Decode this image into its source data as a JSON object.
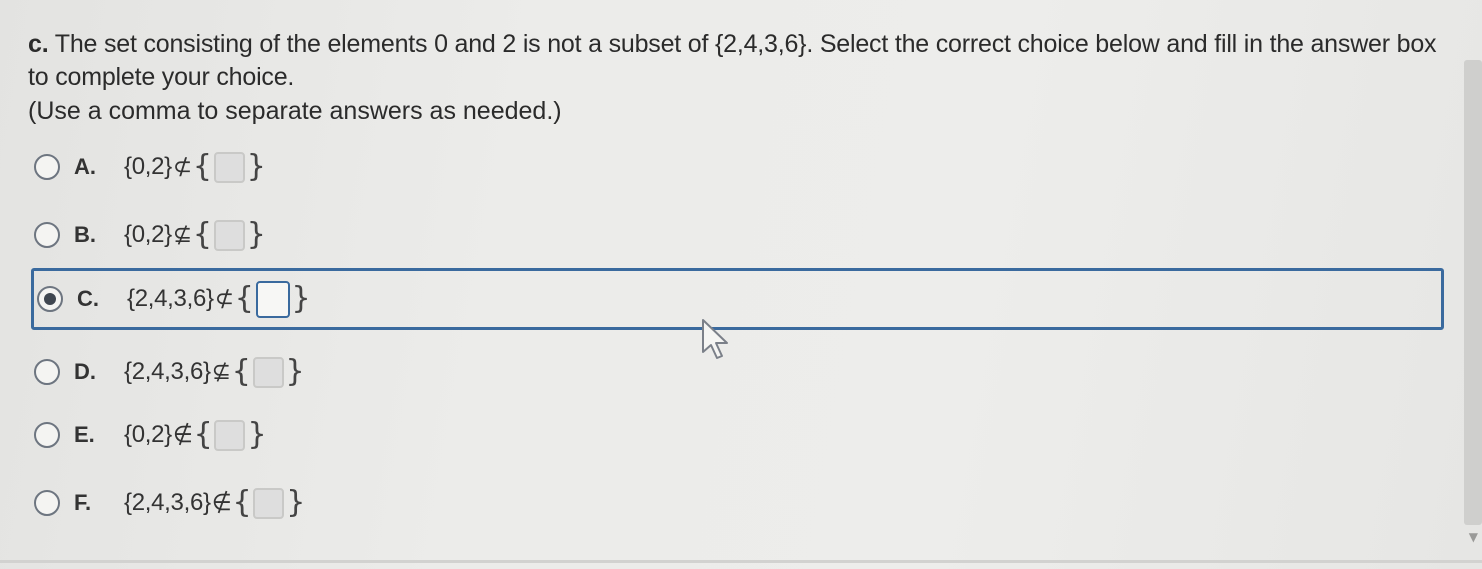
{
  "question": {
    "label": "c.",
    "text": "The set consisting of the elements 0 and 2 is not a subset of {2,4,3,6}. Select the correct choice below and fill in the answer box to complete your choice.",
    "hint": "(Use a comma to separate answers as needed.)"
  },
  "choices": [
    {
      "letter": "A.",
      "left": "{0,2}",
      "symbol": "⊄",
      "selected": false
    },
    {
      "letter": "B.",
      "left": "{0,2}",
      "symbol": "⊈",
      "selected": false
    },
    {
      "letter": "C.",
      "left": "{2,4,3,6}",
      "symbol": "⊄",
      "selected": true
    },
    {
      "letter": "D.",
      "left": "{2,4,3,6}",
      "symbol": "⊈",
      "selected": false
    },
    {
      "letter": "E.",
      "left": "{0,2}",
      "symbol": "∉",
      "selected": false
    },
    {
      "letter": "F.",
      "left": "{2,4,3,6}",
      "symbol": "∉",
      "selected": false
    }
  ],
  "answer_box_value": "",
  "brace_open": "{",
  "brace_close": "}",
  "colors": {
    "accent": "#3a6a9e",
    "text": "#2b2b2b",
    "background": "#ececea"
  },
  "icons": [
    "radio-button-icon",
    "mouse-pointer-icon"
  ]
}
